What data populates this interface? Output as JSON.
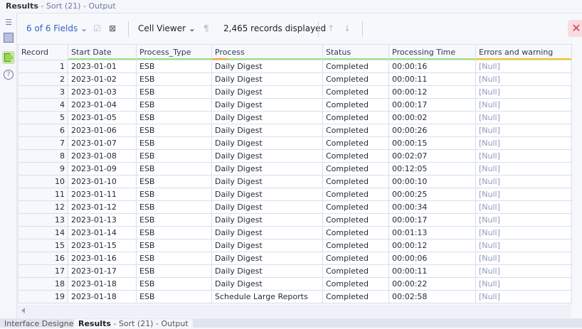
{
  "top_title": {
    "name": "Results",
    "sub": " - Sort (21) - Output"
  },
  "toolbar": {
    "fields": "6 of 6 Fields",
    "cell_viewer": "Cell Viewer",
    "records": "2,465 records displayed"
  },
  "columns": [
    "Record",
    "Start Date",
    "Process_Type",
    "Process",
    "Status",
    "Processing Time",
    "Errors and warning"
  ],
  "rows": [
    [
      "1",
      "2023-01-01",
      "ESB",
      "Daily Digest",
      "Completed",
      "00:00:16",
      "[Null]"
    ],
    [
      "2",
      "2023-01-02",
      "ESB",
      "Daily Digest",
      "Completed",
      "00:00:11",
      "[Null]"
    ],
    [
      "3",
      "2023-01-03",
      "ESB",
      "Daily Digest",
      "Completed",
      "00:00:12",
      "[Null]"
    ],
    [
      "4",
      "2023-01-04",
      "ESB",
      "Daily Digest",
      "Completed",
      "00:00:17",
      "[Null]"
    ],
    [
      "5",
      "2023-01-05",
      "ESB",
      "Daily Digest",
      "Completed",
      "00:00:02",
      "[Null]"
    ],
    [
      "6",
      "2023-01-06",
      "ESB",
      "Daily Digest",
      "Completed",
      "00:00:26",
      "[Null]"
    ],
    [
      "7",
      "2023-01-07",
      "ESB",
      "Daily Digest",
      "Completed",
      "00:00:15",
      "[Null]"
    ],
    [
      "8",
      "2023-01-08",
      "ESB",
      "Daily Digest",
      "Completed",
      "00:02:07",
      "[Null]"
    ],
    [
      "9",
      "2023-01-09",
      "ESB",
      "Daily Digest",
      "Completed",
      "00:12:05",
      "[Null]"
    ],
    [
      "10",
      "2023-01-10",
      "ESB",
      "Daily Digest",
      "Completed",
      "00:00:10",
      "[Null]"
    ],
    [
      "11",
      "2023-01-11",
      "ESB",
      "Daily Digest",
      "Completed",
      "00:00:25",
      "[Null]"
    ],
    [
      "12",
      "2023-01-12",
      "ESB",
      "Daily Digest",
      "Completed",
      "00:00:34",
      "[Null]"
    ],
    [
      "13",
      "2023-01-13",
      "ESB",
      "Daily Digest",
      "Completed",
      "00:00:17",
      "[Null]"
    ],
    [
      "14",
      "2023-01-14",
      "ESB",
      "Daily Digest",
      "Completed",
      "00:01:13",
      "[Null]"
    ],
    [
      "15",
      "2023-01-15",
      "ESB",
      "Daily Digest",
      "Completed",
      "00:00:12",
      "[Null]"
    ],
    [
      "16",
      "2023-01-16",
      "ESB",
      "Daily Digest",
      "Completed",
      "00:00:06",
      "[Null]"
    ],
    [
      "17",
      "2023-01-17",
      "ESB",
      "Daily Digest",
      "Completed",
      "00:00:11",
      "[Null]"
    ],
    [
      "18",
      "2023-01-18",
      "ESB",
      "Daily Digest",
      "Completed",
      "00:00:22",
      "[Null]"
    ],
    [
      "19",
      "2023-01-18",
      "ESB",
      "Schedule Large Reports",
      "Completed",
      "00:02:58",
      "[Null]"
    ]
  ],
  "bottom_tabs": [
    {
      "label": "Interface Designer"
    },
    {
      "label": "Results",
      "sub": " - Sort (21) - Output"
    }
  ]
}
